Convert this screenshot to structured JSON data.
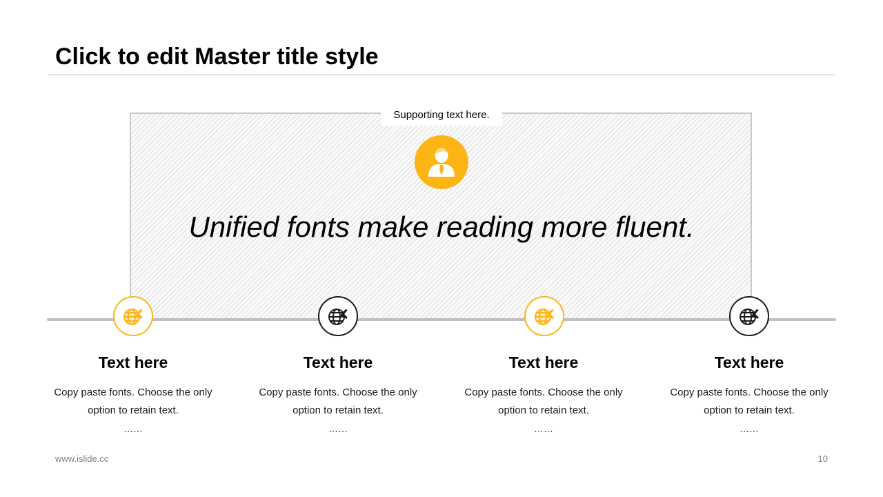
{
  "slide": {
    "title": "Click to edit Master title style",
    "supporting_text": "Supporting text here.",
    "quote": "Unified fonts make reading more fluent.",
    "accent_color": "#fdb515",
    "dark_color": "#1a1a1a"
  },
  "items": [
    {
      "title": "Text here",
      "text": "Copy paste fonts. Choose the only option to retain text.",
      "dots": "……",
      "icon": "globe-plane-icon",
      "style": "accent"
    },
    {
      "title": "Text here",
      "text": "Copy paste fonts. Choose the only option to retain text.",
      "dots": "……",
      "icon": "globe-plane-icon",
      "style": "dark"
    },
    {
      "title": "Text here",
      "text": "Copy paste fonts. Choose the only option to retain text.",
      "dots": "……",
      "icon": "globe-plane-icon",
      "style": "accent"
    },
    {
      "title": "Text here",
      "text": "Copy paste fonts. Choose the only option to retain text.",
      "dots": "……",
      "icon": "globe-plane-icon",
      "style": "dark"
    }
  ],
  "footer": {
    "website": "www.islide.cc",
    "page_number": "10"
  }
}
